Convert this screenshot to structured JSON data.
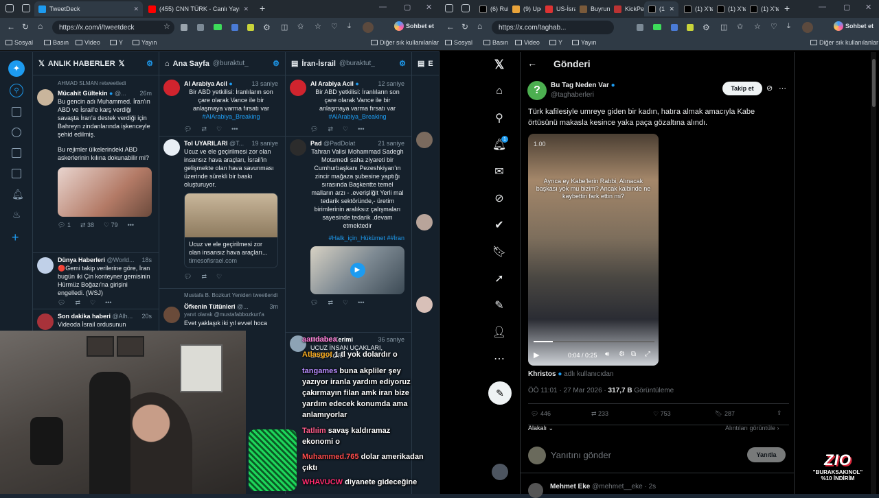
{
  "left_window": {
    "tabs": [
      {
        "label": "TweetDeck",
        "active": true
      },
      {
        "label": "(455) CNN TÜRK - Canlı Yayın",
        "active": false
      }
    ],
    "url": "https://x.com/i/tweetdeck",
    "profile_label": "Sohbet et",
    "bookmarks": [
      "Sosyal",
      "Basın",
      "Video",
      "Y",
      "Yayın"
    ],
    "other_bookmarks": "Diğer sık kullanılanlar"
  },
  "right_window": {
    "tabs": [
      "(6) Rub",
      "(9) Upc",
      "US-İsrail",
      "Buyrun",
      "KickPer",
      "(1",
      "(1) X'te",
      "(1) X'te",
      "(1) X'te"
    ],
    "url": "https://x.com/taghab...",
    "profile_label": "Sohbet et",
    "bookmarks": [
      "Sosyal",
      "Basın",
      "Video",
      "Y",
      "Yayın"
    ],
    "other_bookmarks": "Diğer sık kullanılanlar"
  },
  "deck": {
    "columns": [
      {
        "title": "ANLIK HABERLER",
        "handle": ""
      },
      {
        "title": "Ana Sayfa",
        "handle": "@buraktut_"
      },
      {
        "title": "İran-İsrail",
        "handle": "@buraktut_"
      },
      {
        "title": "E",
        "handle": ""
      }
    ],
    "col1": [
      {
        "retweet": "AHMAD SLMAN retweetledi",
        "name": "Mücahit Gültekin",
        "handle": "@...",
        "time": "26m",
        "text": "Bu gencin adı Muhammed. İran'ın ABD ve İsrail'e karş verdiği savaşta İran'a destek verdiği için Bahreyn zindanlarında işkenceyle şehid edilmiş.",
        "text2": "Bu rejimler ülkelerindeki ABD askerlerinin kılına dokunabilir mi?",
        "replies": "1",
        "retweets": "38",
        "likes": "79"
      },
      {
        "name": "Dünya Haberleri",
        "handle": "@World...",
        "time": "18s",
        "text": "🔴Gemi takip verilerine göre, İran bugün iki Çin konteyner gemisinin Hürmüz Boğazı'na girişini engelledi. (WSJ)"
      },
      {
        "name": "Son dakika haberi",
        "handle": "@Alh...",
        "time": "20s",
        "text": "Videoda İsrail ordusunun"
      }
    ],
    "col2": [
      {
        "name": "Al Arabiya Acil",
        "time": "13 saniye",
        "text": "Bir ABD yetkilisi: İranlıların son çare olarak Vance ile bir anlaşmaya varma fırsatı var",
        "tag": "#AlArabiya_Breaking"
      },
      {
        "name": "Tol UYARILARI",
        "handle": "@T...",
        "time": "19 saniye",
        "text": "Ucuz ve ele geçirilmesi zor olan insansız hava araçları, İsrail'in gelişmekte olan hava savunması üzerinde sürekli bir baskı oluşturuyor.",
        "card_title": "Ucuz ve ele geçirilmesi zor olan insansız hava araçları...",
        "card_domain": "timesofisrael.com"
      },
      {
        "retweet": "Mustafa B. Bozkurt Yeniden tweetlendi",
        "name": "Öfkenin Tütünleri",
        "handle": "@...",
        "time": "3m",
        "reply_to": "yanıt olarak @mustafabbozkurt'a",
        "text": "Evet yaklaşık iki yıl evvel hoca"
      }
    ],
    "col3": [
      {
        "name": "Al Arabiya Acil",
        "time": "12 saniye",
        "text": "Bir ABD yetkilisi: İranlıların son çare olarak Vance ile bir anlaşmaya varma fırsatı var",
        "tag": "#AlArabiya_Breaking"
      },
      {
        "name": "Pad",
        "handle": "@PadDolat",
        "time": "21 saniye",
        "text": "Tahran Valisi Mohammad Sadegh Motamedi saha ziyareti bir Cumhurbaşkanı Pezeshkiyan'ın zincir mağaza şubesine yaptığı sırasında Başkentte temel malların arzı - .everişliğit Yerli mal tedarik sektöründe,- üretim birimlerinin aralıksız çalışmaları sayesinde tedarik .devam etmektedir",
        "tags": "#Halk_için_Hükümet ##İran"
      },
      {
        "name": "Mersad Kerimi",
        "time": "36 saniye",
        "text": "UCUZ İNSAN UÇAKLARI, SAĞLIYOR"
      }
    ]
  },
  "chat_overlay": [
    {
      "user": "aandabea",
      "msg": "",
      "color": "#ff7ad9"
    },
    {
      "user": "Atlasgot",
      "msg": "1 tl yok dolardır o",
      "color": "#ffb020"
    },
    {
      "user": "tangames",
      "msg": "buna akpliler şey yazıyor iranla yardım ediyoruz çakırmayın filan amk iran bize yardım edecek konumda ama anlamıyorlar",
      "color": "#b98cff"
    },
    {
      "user": "Tatlıim",
      "msg": "savaş kaldıramaz ekonomi o",
      "color": "#ff5c8a"
    },
    {
      "user": "Muhammed.765",
      "msg": "dolar amerikadan çıktı",
      "color": "#ff4d4d"
    },
    {
      "user": "WHAVUCW",
      "msg": "diyanete gideceğine",
      "color": "#ff2b6e"
    }
  ],
  "x_post": {
    "page_title": "Gönderi",
    "author_name": "Bu Tag Neden Var",
    "author_handle": "@taghaberleri",
    "follow_label": "Takip et",
    "text": "Türk kafilesiyle umreye giden bir kadın, hatıra almak amacıyla Kabe örtüsünü makasla kesince yaka paça gözaltına alındı.",
    "video_overlay": "Ayrıca ey Kabe'lerin Rabbi, Alınacak başkası yok mu bizim? Ancak kalbinde ne kaybettin fark ettin mi?",
    "video_rate": "1.00",
    "video_time": "0:04 / 0:25",
    "tagged_name": "Khristos",
    "tagged_suffix": "adlı kullanıcıdan",
    "timestamp": "ÖÖ 11:01 · 27 Mar 2026",
    "views": "317,7 B",
    "views_label": "Görüntüleme",
    "replies": "446",
    "reposts": "233",
    "likes": "753",
    "bookmarks": "287",
    "sort_label": "Alakalı",
    "quotes_label": "Alıntıları görüntüle",
    "reply_placeholder": "Yanıtını gönder",
    "reply_button": "Yanıtla",
    "next_name": "Mehmet Eke",
    "next_handle": "@mehmet__eke",
    "next_time": "2s"
  },
  "promo": {
    "brand": "ZIO",
    "code": "\"BURAKSAKINOL\"",
    "discount": "%10 İNDİRİM"
  },
  "colors": {
    "accent": "#1d9bf0",
    "deck_bg": "#15202b",
    "x_bg": "#000000",
    "verified": "#1d9bf0",
    "green_avatar": "#4caf50"
  },
  "notification_badge": "1"
}
